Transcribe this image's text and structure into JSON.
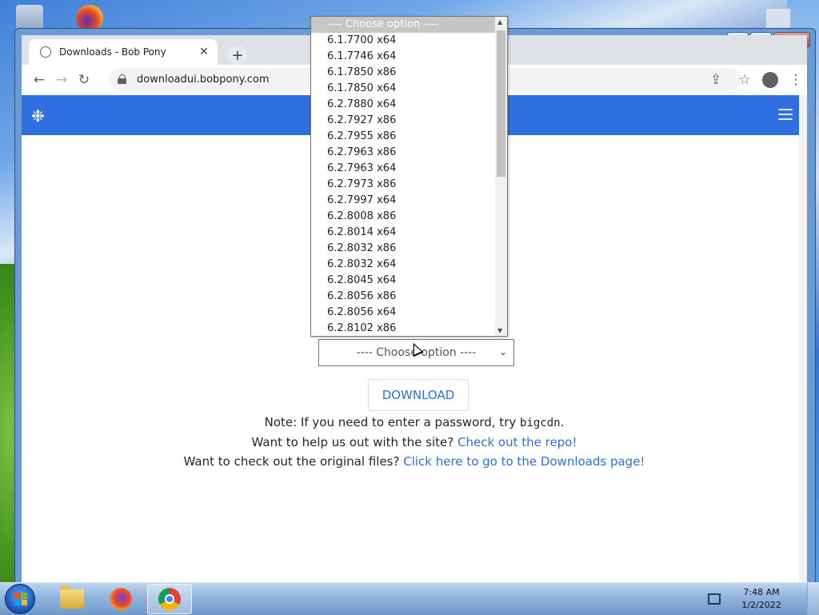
{
  "tab": {
    "title": "Downloads - Bob Pony",
    "close": "✕",
    "new_tab": "+"
  },
  "toolbar": {
    "back": "←",
    "forward": "→",
    "reload": "↻",
    "url": "downloadui.bobpony.com",
    "share": "⇪",
    "star": "☆",
    "menu": "⋮"
  },
  "window": {
    "minimize": "—",
    "maximize": "□",
    "close": "✕"
  },
  "page": {
    "logo": "❉",
    "select_value": "---- Choose option ----",
    "download_label": "DOWNLOAD",
    "note_prefix": "Note: If you need to enter a password, try ",
    "note_code": "bigcdn",
    "note_suffix": ".",
    "help_prefix": "Want to help us out with the site? ",
    "help_link": "Check out the repo!",
    "files_prefix": "Want to check out the original files? ",
    "files_link": "Click here to go to the Downloads page!"
  },
  "dropdown": {
    "options": [
      "---- Choose option ----",
      "6.1.7700 x64",
      "6.1.7746 x64",
      "6.1.7850 x86",
      "6.1.7850 x64",
      "6.2.7880 x64",
      "6.2.7927 x86",
      "6.2.7955 x86",
      "6.2.7963 x86",
      "6.2.7963 x64",
      "6.2.7973 x86",
      "6.2.7997 x64",
      "6.2.8008 x86",
      "6.2.8014 x64",
      "6.2.8032 x86",
      "6.2.8032 x64",
      "6.2.8045 x64",
      "6.2.8056 x86",
      "6.2.8056 x64",
      "6.2.8102 x86"
    ]
  },
  "taskbar": {
    "apps": [
      "file-explorer",
      "firefox",
      "chrome"
    ],
    "time": "7:48 AM",
    "date": "1/2/2022"
  }
}
